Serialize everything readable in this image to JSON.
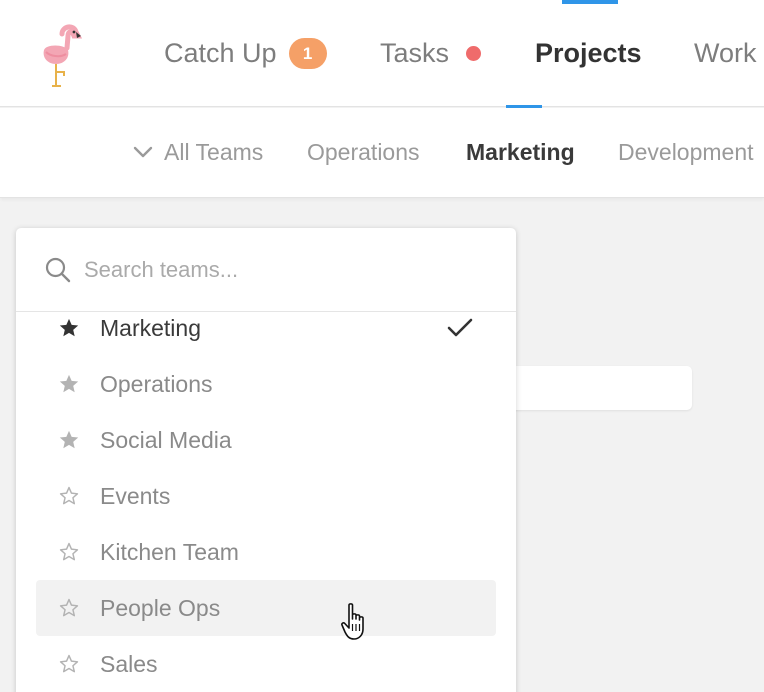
{
  "top_nav": {
    "items": [
      {
        "label": "Catch Up",
        "badge": "1"
      },
      {
        "label": "Tasks"
      },
      {
        "label": "Projects"
      },
      {
        "label": "Work"
      }
    ]
  },
  "sub_nav": {
    "items": [
      {
        "label": "All Teams"
      },
      {
        "label": "Operations"
      },
      {
        "label": "Marketing"
      },
      {
        "label": "Development"
      }
    ]
  },
  "search": {
    "placeholder": "Search teams..."
  },
  "teams": [
    {
      "label": "Marketing",
      "starred": true,
      "selected": true
    },
    {
      "label": "Operations",
      "starred": true
    },
    {
      "label": "Social Media",
      "starred": true
    },
    {
      "label": "Events",
      "starred": false
    },
    {
      "label": "Kitchen Team",
      "starred": false
    },
    {
      "label": "People Ops",
      "starred": false,
      "hovered": true
    },
    {
      "label": "Sales",
      "starred": false
    }
  ],
  "colors": {
    "accent": "#2f95e8",
    "badge": "#f5a067",
    "notification_dot": "#ef6b6b",
    "star_filled_selected": "#333333",
    "star_filled": "#b3b3b3"
  }
}
